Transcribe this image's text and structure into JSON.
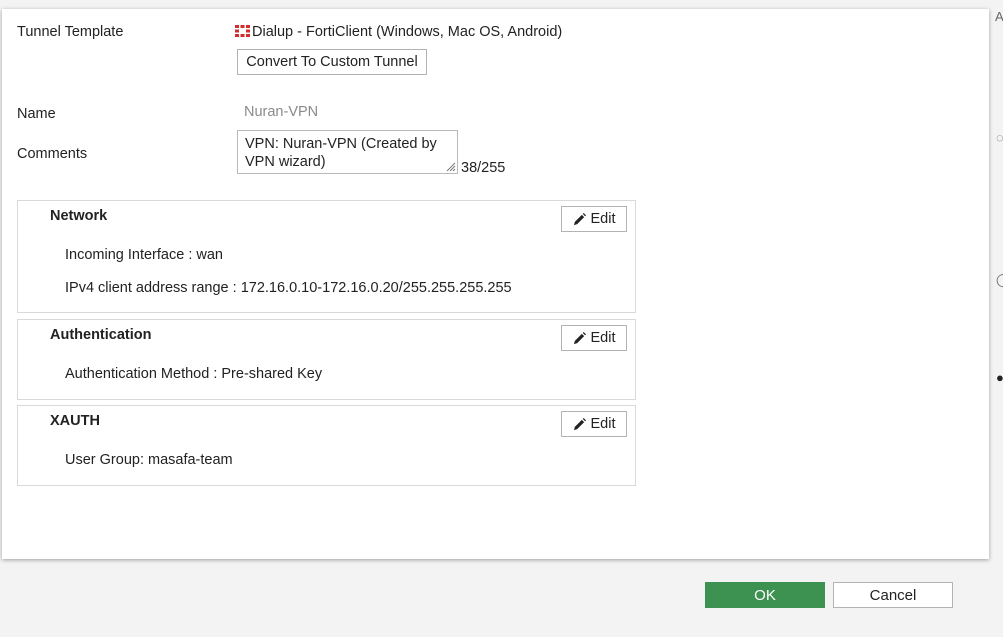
{
  "form": {
    "tunnel_template_label": "Tunnel Template",
    "tunnel_template_value": "Dialup - FortiClient (Windows, Mac OS, Android)",
    "convert_button": "Convert To Custom Tunnel",
    "name_label": "Name",
    "name_value": "Nuran-VPN",
    "comments_label": "Comments",
    "comments_value": "VPN: Nuran-VPN (Created by VPN wizard)",
    "comments_counter": "38/255"
  },
  "sections": [
    {
      "title": "Network",
      "edit_label": "Edit",
      "details": [
        "Incoming Interface : wan",
        "IPv4 client address range : 172.16.0.10-172.16.0.20/255.255.255.255"
      ]
    },
    {
      "title": "Authentication",
      "edit_label": "Edit",
      "details": [
        "Authentication Method : Pre-shared Key"
      ]
    },
    {
      "title": "XAUTH",
      "edit_label": "Edit",
      "details": [
        "User Group: masafa-team"
      ]
    }
  ],
  "footer": {
    "ok_label": "OK",
    "cancel_label": "Cancel"
  },
  "icons": {
    "template_logo": "fortinet-logo-icon",
    "edit": "pencil-icon"
  },
  "colors": {
    "ok_button": "#3d9151",
    "logo_red": "#d42d2d",
    "muted_value": "#8a8a8a"
  }
}
